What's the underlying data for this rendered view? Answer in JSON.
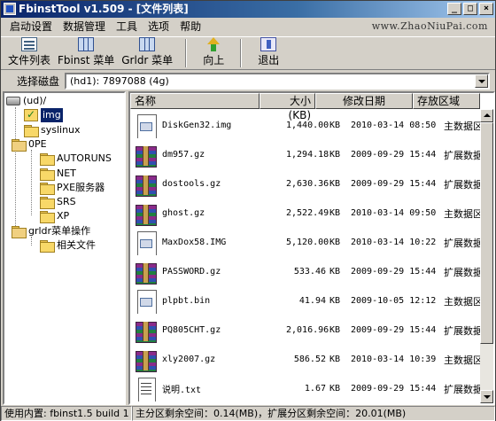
{
  "window": {
    "title": "FbinstTool v1.509 - [文件列表]"
  },
  "titlebar_buttons": {
    "minimize": "_",
    "maximize": "□",
    "close": "×"
  },
  "menu": {
    "items": [
      "启动设置",
      "数据管理",
      "工具",
      "选项",
      "帮助"
    ],
    "site": "www.ZhaoNiuPai.com"
  },
  "toolbar": {
    "file_list": "文件列表",
    "fbinst_menu": "Fbinst 菜单",
    "grldr_menu": "Grldr 菜单",
    "up": "向上",
    "exit": "退出"
  },
  "drive": {
    "label": "选择磁盘",
    "value": "(hd1): 7897088 (4g)"
  },
  "tree": {
    "root": "(ud)/",
    "items": [
      "img",
      "syslinux",
      "0PE",
      "AUTORUNS",
      "NET",
      "PXE服务器",
      "SRS",
      "XP",
      "grldr菜单操作",
      "相关文件"
    ]
  },
  "list": {
    "headers": {
      "name": "名称",
      "size": "大小 (KB)",
      "date": "修改日期",
      "area": "存放区域"
    },
    "rows": [
      {
        "name": "DiskGen32.img",
        "size": "1,440.00",
        "unit": "KB",
        "date": "2010-03-14 08:50",
        "area": "主数据区",
        "icon": "doc"
      },
      {
        "name": "dm957.gz",
        "size": "1,294.18",
        "unit": "KB",
        "date": "2009-09-29 15:44",
        "area": "扩展数据区",
        "icon": "rar"
      },
      {
        "name": "dostools.gz",
        "size": "2,630.36",
        "unit": "KB",
        "date": "2009-09-29 15:44",
        "area": "扩展数据区",
        "icon": "rar"
      },
      {
        "name": "ghost.gz",
        "size": "2,522.49",
        "unit": "KB",
        "date": "2010-03-14 09:50",
        "area": "主数据区",
        "icon": "rar"
      },
      {
        "name": "MaxDox58.IMG",
        "size": "5,120.00",
        "unit": "KB",
        "date": "2010-03-14 10:22",
        "area": "扩展数据区",
        "icon": "doc"
      },
      {
        "name": "PASSWORD.gz",
        "size": "533.46",
        "unit": "KB",
        "date": "2009-09-29 15:44",
        "area": "扩展数据区",
        "icon": "rar"
      },
      {
        "name": "plpbt.bin",
        "size": "41.94",
        "unit": "KB",
        "date": "2009-10-05 12:12",
        "area": "主数据区",
        "icon": "doc"
      },
      {
        "name": "PQ805CHT.gz",
        "size": "2,016.96",
        "unit": "KB",
        "date": "2009-09-29 15:44",
        "area": "扩展数据区",
        "icon": "rar"
      },
      {
        "name": "xly2007.gz",
        "size": "586.52",
        "unit": "KB",
        "date": "2010-03-14 10:39",
        "area": "主数据区",
        "icon": "rar"
      },
      {
        "name": "说明.txt",
        "size": "1.67",
        "unit": "KB",
        "date": "2009-09-29 15:44",
        "area": "扩展数据区",
        "icon": "txt"
      }
    ]
  },
  "status": {
    "left": "使用内置: fbinst1.5 build 1",
    "right": "主分区剩余空间：0.14(MB)，扩展分区剩余空间：20.01(MB)"
  }
}
